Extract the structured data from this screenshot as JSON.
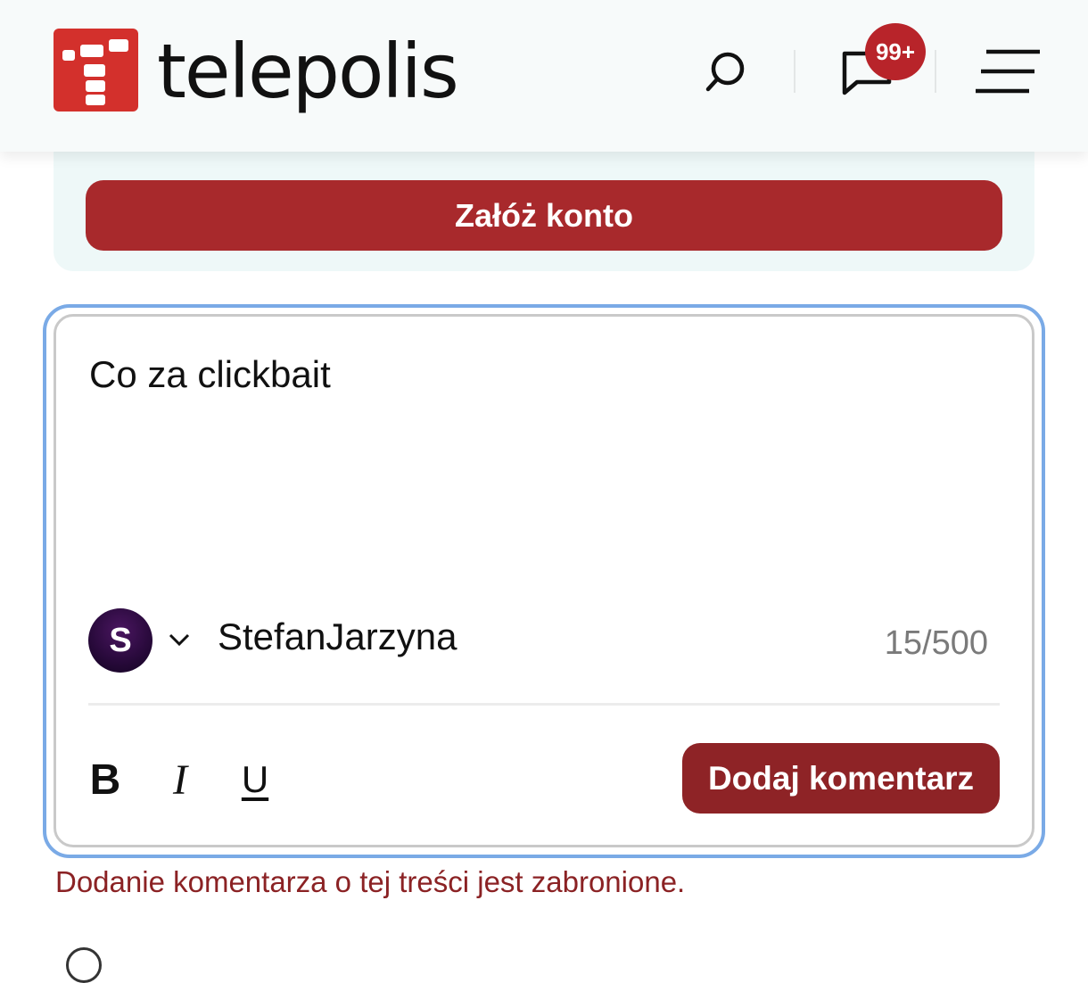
{
  "header": {
    "brand": "telepolis",
    "notification_count": "99+",
    "icons": {
      "logo": "telepolis-logo-icon",
      "search": "search-icon",
      "comments": "comment-bubble-icon",
      "menu": "hamburger-menu-icon"
    }
  },
  "signup": {
    "button_label": "Załóż konto"
  },
  "comment_form": {
    "text_value": "Co za clickbait",
    "avatar_initial": "S",
    "username": "StefanJarzyna",
    "char_counter": "15/500",
    "format_bold": "B",
    "format_italic": "I",
    "format_underline": "U",
    "submit_label": "Dodaj komentarz",
    "error_message": "Dodanie komentarza o tej treści jest zabronione."
  },
  "colors": {
    "brand_red": "#d3302c",
    "button_red": "#a8292c",
    "submit_red": "#8e2326",
    "focus_blue": "#7aaae6",
    "error_red": "#8b2224"
  }
}
